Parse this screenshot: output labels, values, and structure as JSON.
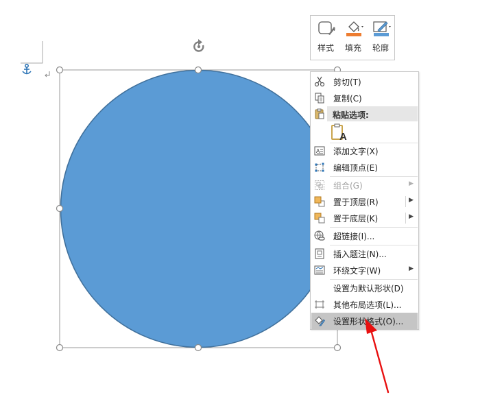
{
  "mini_toolbar": {
    "style_label": "样式",
    "fill_label": "填充",
    "outline_label": "轮廓"
  },
  "context_menu": {
    "cut": "剪切(T)",
    "copy": "复制(C)",
    "paste_options": "粘贴选项:",
    "add_text": "添加文字(X)",
    "edit_points": "编辑顶点(E)",
    "group": "组合(G)",
    "bring_to_front": "置于顶层(R)",
    "send_to_back": "置于底层(K)",
    "hyperlink": "超链接(I)...",
    "insert_caption": "插入题注(N)...",
    "wrap_text": "环绕文字(W)",
    "set_default_shape": "设置为默认形状(D)",
    "more_layout_options": "其他布局选项(L)...",
    "format_shape": "设置形状格式(O)..."
  },
  "colors": {
    "shape_fill": "#5b9bd5",
    "shape_outline": "#41719c",
    "annotation_arrow": "#e81010",
    "highlight": "#c5c5c5",
    "anchor": "#2e75b6"
  }
}
